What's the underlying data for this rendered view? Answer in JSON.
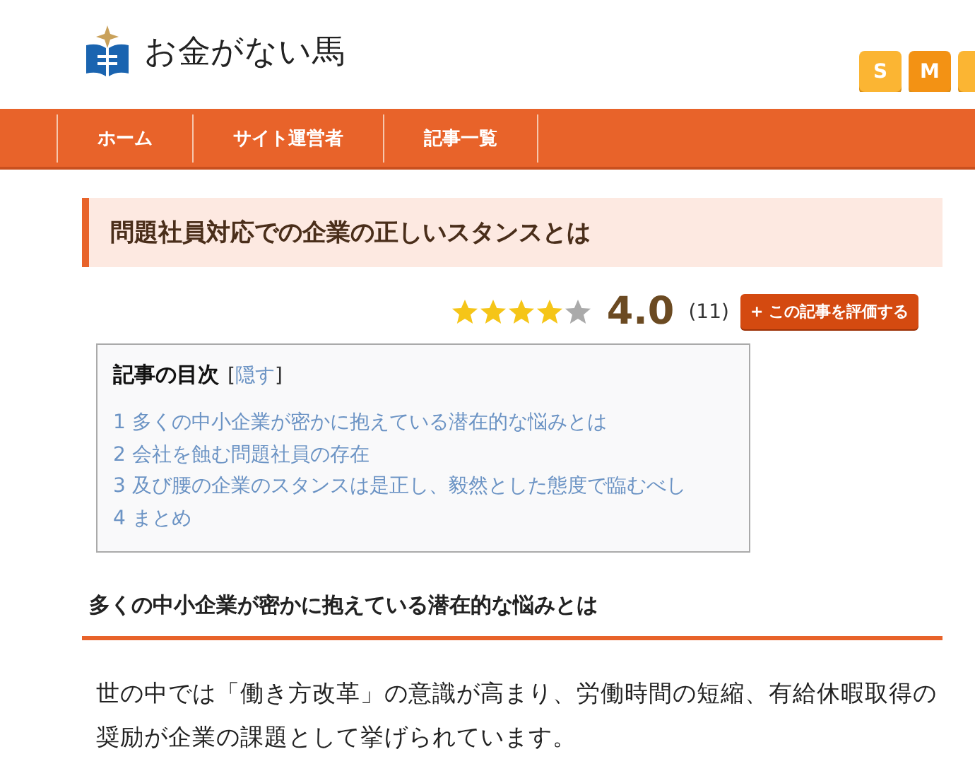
{
  "site": {
    "title": "お金がない馬"
  },
  "font_size_buttons": [
    {
      "label": "S",
      "selected": false
    },
    {
      "label": "M",
      "selected": true
    },
    {
      "selected": false
    }
  ],
  "nav": [
    "ホーム",
    "サイト運営者",
    "記事一覧"
  ],
  "article": {
    "title": "問題社員対応での企業の正しいスタンスとは",
    "rating": {
      "stars": 4,
      "score": "4.0",
      "count": "(11)",
      "button": "+ この記事を評価する"
    },
    "toc": {
      "title": "記事の目次",
      "toggle_open": "[",
      "toggle": "隠す",
      "toggle_close": "]",
      "items": [
        "1 多くの中小企業が密かに抱えている潜在的な悩みとは",
        "2 会社を蝕む問題社員の存在",
        "3 及び腰の企業のスタンスは是正し、毅然とした態度で臨むべし",
        "4 まとめ"
      ]
    },
    "section_heading": "多くの中小企業が密かに抱えている潜在的な悩みとは",
    "paragraph": "世の中では「働き方改革」の意識が高まり、労働時間の短縮、有給休暇取得の奨励が企業の課題として挙げられています。"
  }
}
